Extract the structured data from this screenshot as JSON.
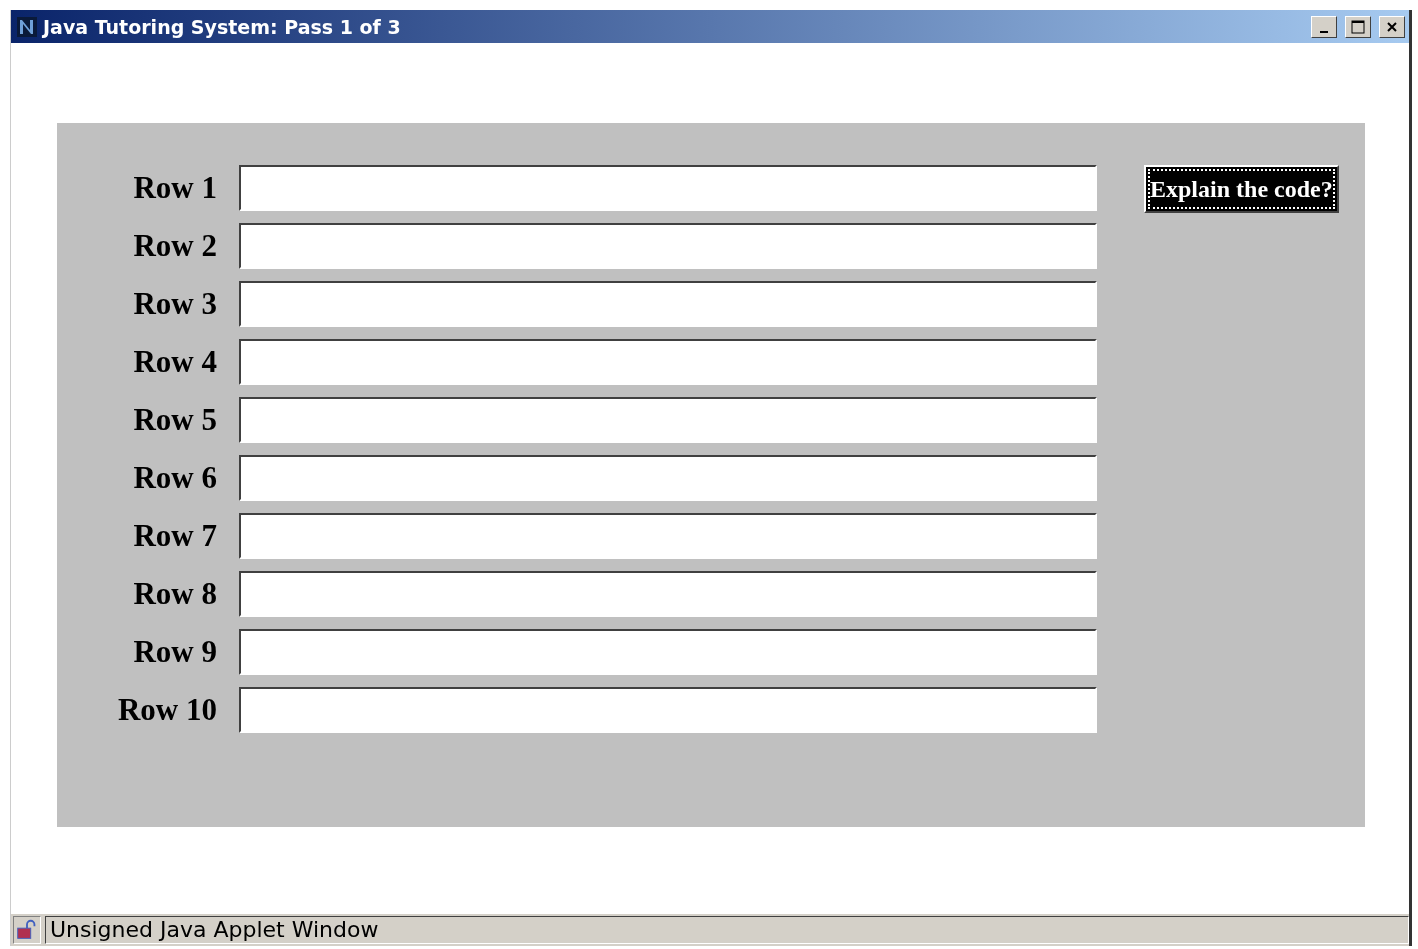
{
  "window": {
    "title": "Java Tutoring System: Pass 1 of 3"
  },
  "rows": [
    {
      "label": "Row 1"
    },
    {
      "label": "Row 2"
    },
    {
      "label": "Row 3"
    },
    {
      "label": "Row 4"
    },
    {
      "label": "Row 5"
    },
    {
      "label": "Row 6"
    },
    {
      "label": "Row 7"
    },
    {
      "label": "Row 8"
    },
    {
      "label": "Row 9"
    },
    {
      "label": "Row 10"
    }
  ],
  "explain_button": {
    "label": "Explain the code?",
    "focused": true
  },
  "status_bar": {
    "text": "Unsigned Java Applet Window"
  }
}
